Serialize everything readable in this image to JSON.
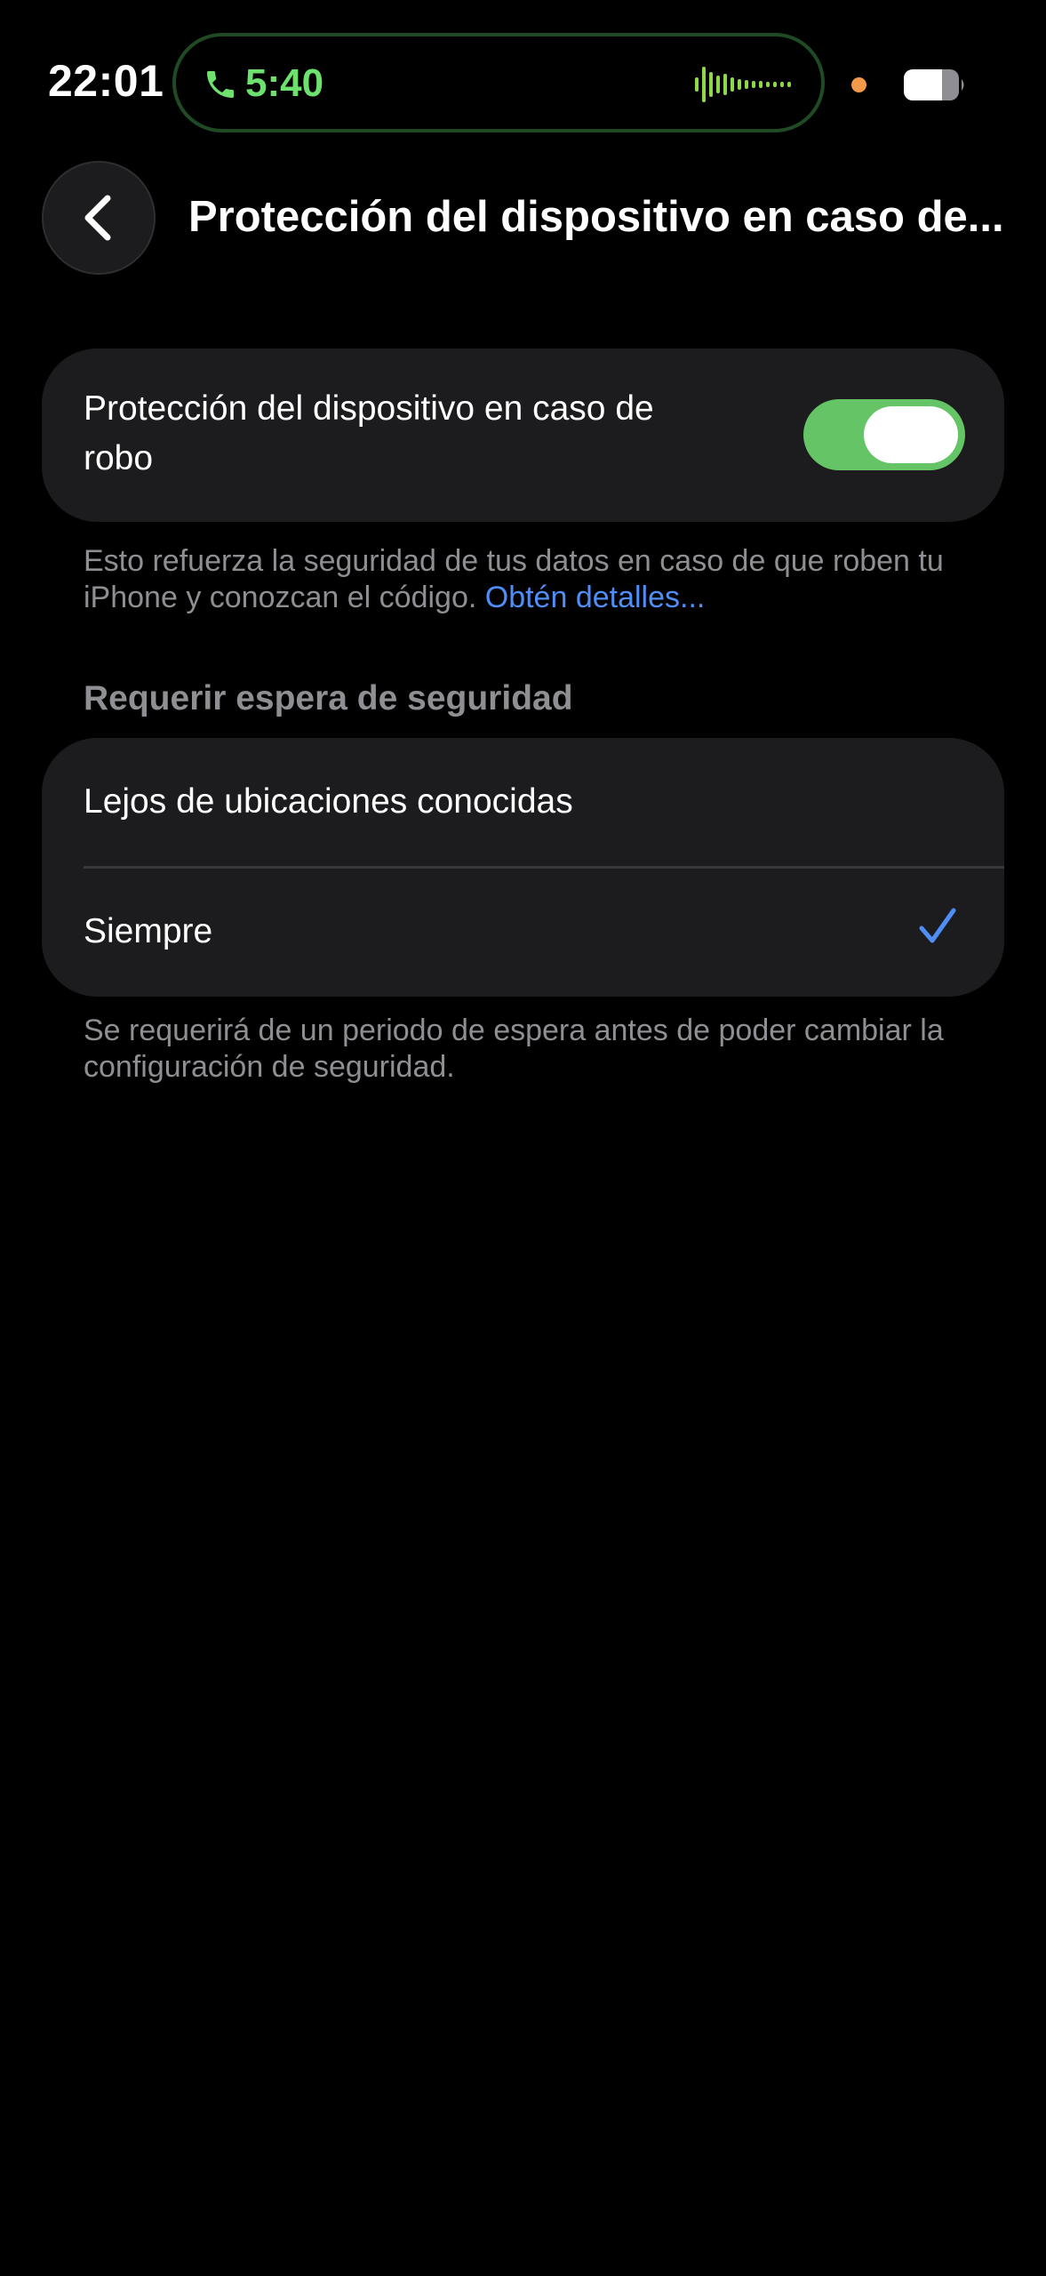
{
  "status_bar": {
    "time": "22:01",
    "call_timer": "5:40",
    "call_icon": "phone-icon",
    "waveform_icon": "audio-waveform-icon",
    "battery_icon": "battery-icon",
    "recording_dot_color": "#f2994a",
    "call_color": "#6ee06e"
  },
  "header": {
    "back_icon": "chevron-left-icon",
    "title": "Protección del dispositivo en caso de..."
  },
  "toggle_card": {
    "label": "Protección del dispositivo en caso de robo",
    "enabled": true,
    "toggle_color": "#65c466"
  },
  "footnote_protection": {
    "text": "Esto refuerza la seguridad de tus datos en caso de que roben tu iPhone y conozcan el código. ",
    "link": "Obtén detalles...",
    "link_color": "#4f8ef7"
  },
  "security_delay": {
    "header": "Requerir espera de seguridad",
    "options": [
      {
        "label": "Lejos de ubicaciones conocidas",
        "selected": false
      },
      {
        "label": "Siempre",
        "selected": true
      }
    ],
    "check_icon": "checkmark-icon",
    "footnote": "Se requerirá de un periodo de espera antes de poder cambiar la configuración de seguridad."
  }
}
